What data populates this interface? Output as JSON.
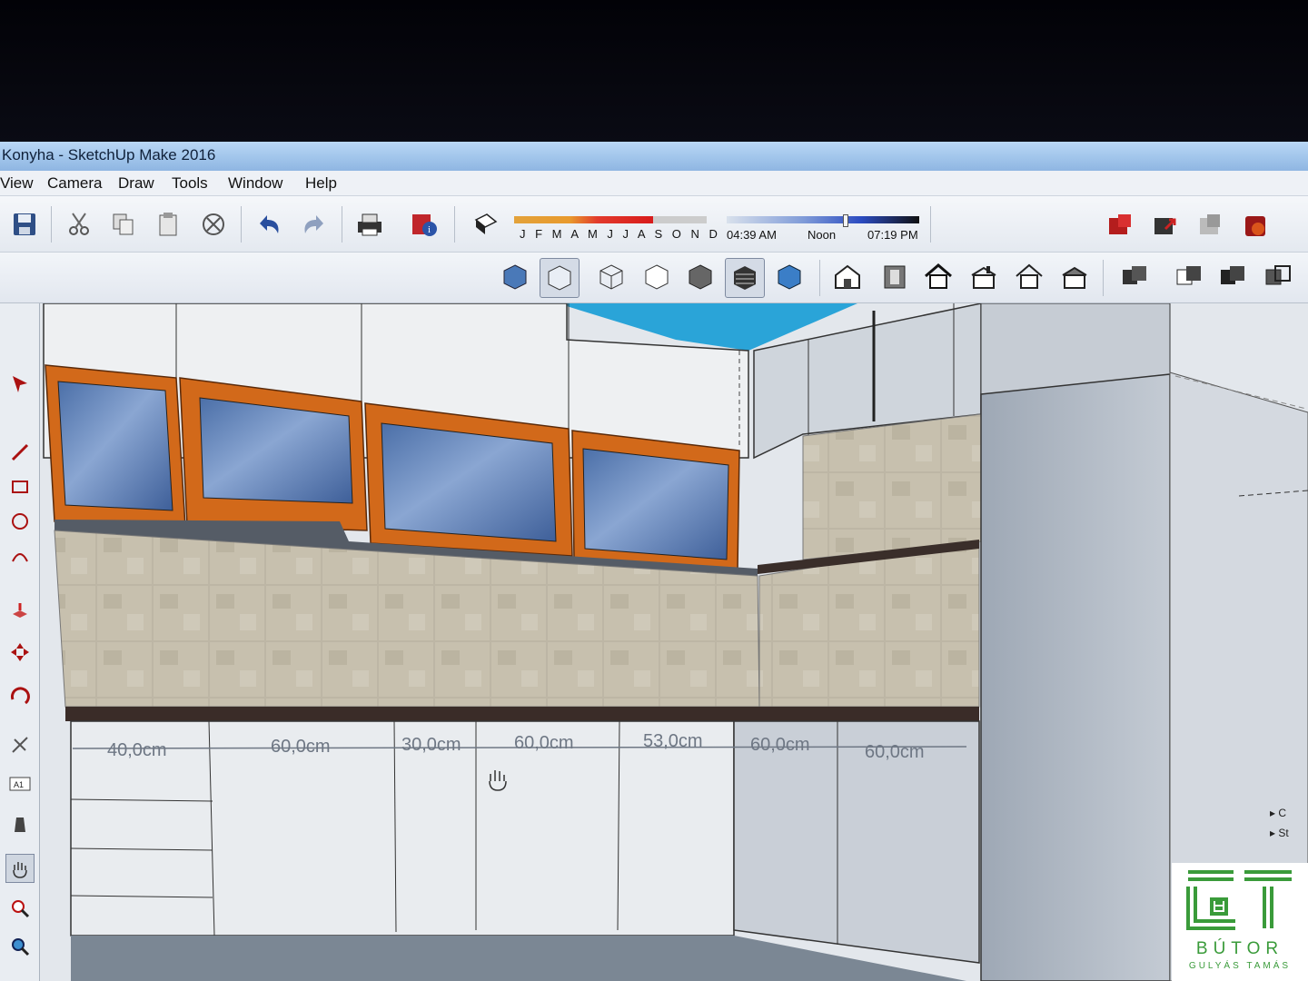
{
  "window": {
    "title": "Konyha - SketchUp Make 2016"
  },
  "menu": [
    "View",
    "Camera",
    "Draw",
    "Tools",
    "Window",
    "Help"
  ],
  "shadow": {
    "months": "J F M A M J J A S O N D",
    "time_start": "04:39 AM",
    "time_mid": "Noon",
    "time_end": "07:19 PM",
    "month_fill": 0.72,
    "time_fill": 0.62
  },
  "dimensions": [
    "40,0cm",
    "60,0cm",
    "30,0cm",
    "60,0cm",
    "53,0cm",
    "60,0cm",
    "60,0cm"
  ],
  "right_panel": [
    "C",
    "St"
  ],
  "logo": {
    "name": "BÚTOR",
    "owner": "GULYÁS TAMÁS"
  },
  "colors": {
    "accent_frame": "#d2691a",
    "glass": "#6a87b8",
    "tile": "#bdb6a5",
    "cabinet": "#d9dde3",
    "sky": "#2aa4d8"
  },
  "icons": {
    "toolbar1": [
      "save-icon",
      "cut-icon",
      "copy-icon",
      "paste-icon",
      "erase-icon",
      "undo-icon",
      "redo-icon",
      "print-icon",
      "model-info-icon",
      "shadows-icon"
    ],
    "toolbar1_right": [
      "3d-warehouse-icon",
      "share-model-icon",
      "get-models-icon",
      "extension-warehouse-icon"
    ],
    "toolbar2_styles": [
      "xray-icon",
      "back-edges-icon",
      "wireframe-icon",
      "hidden-line-icon",
      "shaded-icon",
      "shaded-textures-icon",
      "monochrome-icon"
    ],
    "toolbar2_views": [
      "iso-view-icon",
      "top-view-icon",
      "front-view-icon",
      "right-view-icon",
      "back-view-icon",
      "left-view-icon"
    ],
    "toolbar2_right": [
      "component-icon",
      "group-icon",
      "solid-tools-icon",
      "outer-shell-icon"
    ],
    "left_tools": [
      "select-icon",
      "line-icon",
      "rectangle-icon",
      "circle-icon",
      "arc-icon",
      "push-pull-icon",
      "move-icon",
      "rotate-icon",
      "scale-icon",
      "offset-icon",
      "tape-icon",
      "text-icon",
      "paint-icon",
      "orbit-icon",
      "pan-icon",
      "zoom-icon",
      "zoom-extents-icon"
    ]
  }
}
